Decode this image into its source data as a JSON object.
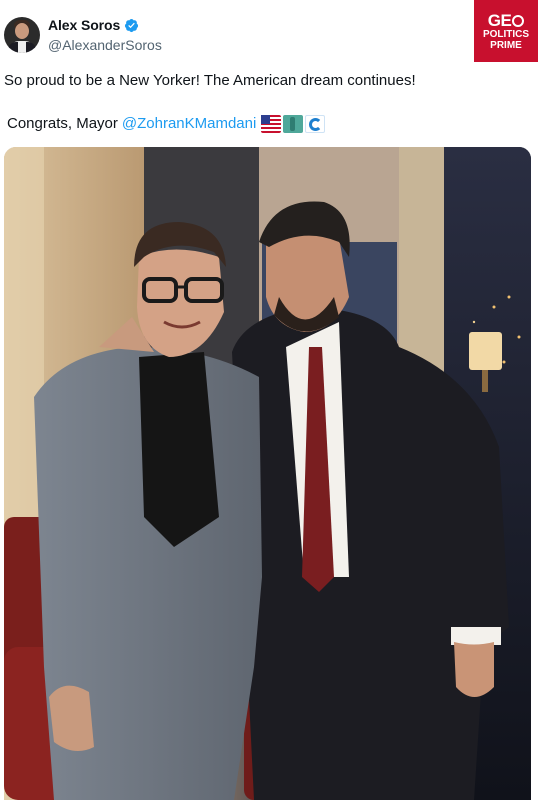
{
  "tweet": {
    "author": {
      "display_name": "Alex Soros",
      "handle": "@AlexanderSoros",
      "verified": true
    },
    "text_line1": "So proud to be a New Yorker! The American dream continues!",
    "text_line2_prefix": "Congrats, Mayor",
    "mention": "@ZohranKMamdani",
    "emojis": [
      "us-flag-emoji",
      "statue-of-liberty-emoji",
      "water-wave-emoji"
    ],
    "photo": {
      "description_alt": ""
    }
  },
  "logo": {
    "line1": "GE",
    "line2": "POLITICS",
    "line3": "PRIME",
    "color": "#c8102e"
  },
  "colors": {
    "link": "#1d9bf0",
    "handle": "#536471",
    "verified": "#1d9bf0"
  }
}
